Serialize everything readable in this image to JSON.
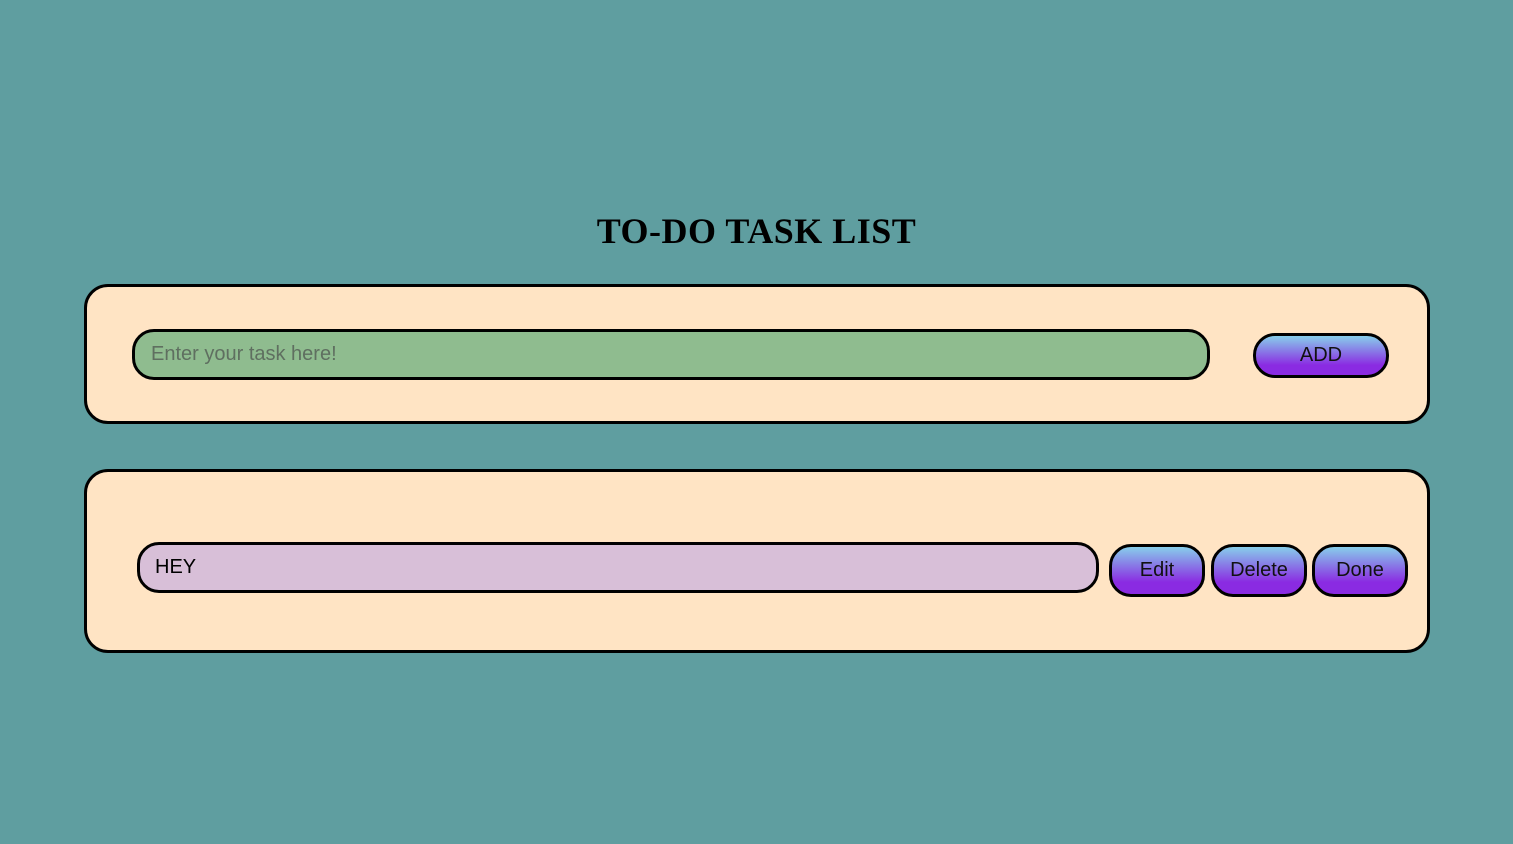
{
  "header": {
    "title": "TO-DO TASK LIST"
  },
  "input_panel": {
    "placeholder": "Enter your task here!",
    "value": "",
    "add_label": "ADD"
  },
  "tasks": [
    {
      "text": "HEY",
      "edit_label": "Edit",
      "delete_label": "Delete",
      "done_label": "Done"
    }
  ],
  "colors": {
    "background": "#5f9ea0",
    "panel": "#ffe4c4",
    "input": "#8fbc8f",
    "task": "#d8bfd8",
    "button_top": "#87ceeb",
    "button_bottom": "#8a2be2"
  }
}
